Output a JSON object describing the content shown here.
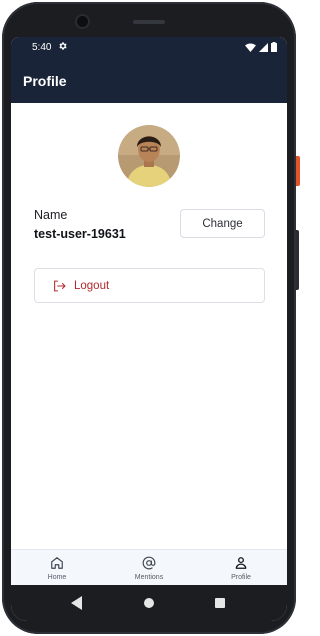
{
  "status_bar": {
    "time": "5:40",
    "icons": [
      "gear-icon",
      "wifi-icon",
      "signal-icon",
      "battery-icon"
    ]
  },
  "app_bar": {
    "title": "Profile"
  },
  "profile": {
    "name_label": "Name",
    "username": "test-user-19631",
    "change_label": "Change",
    "logout_label": "Logout"
  },
  "bottom_nav": {
    "items": [
      {
        "label": "Home",
        "icon": "home-icon"
      },
      {
        "label": "Mentions",
        "icon": "at-sign-icon"
      },
      {
        "label": "Profile",
        "icon": "person-icon"
      }
    ]
  },
  "colors": {
    "app_bar_bg": "#1a2438",
    "logout_red": "#b32a2f",
    "nav_bg": "#f4f7fb"
  }
}
